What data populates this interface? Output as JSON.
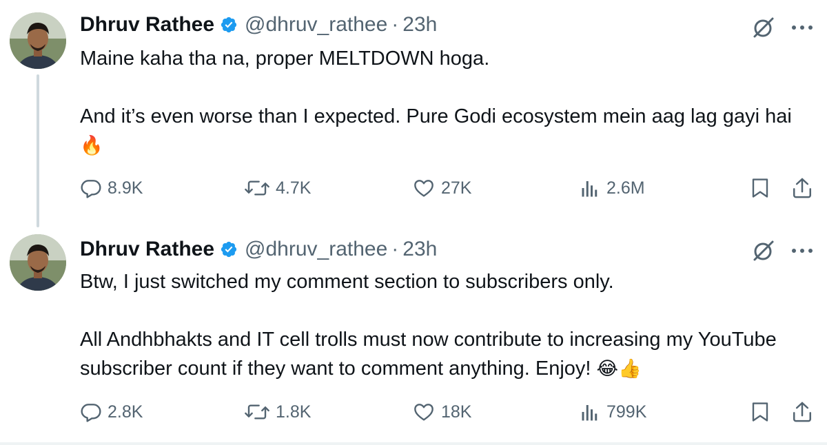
{
  "tweets": [
    {
      "author": {
        "name": "Dhruv Rathee",
        "handle": "@dhruv_rathee",
        "verified": true
      },
      "separator": "·",
      "time": "23h",
      "text": "Maine kaha tha na, proper MELTDOWN hoga.\n\nAnd it’s even worse than I expected. Pure Godi ecosystem mein aag lag gayi hai ",
      "emoji": "🔥",
      "stats": {
        "replies": "8.9K",
        "reposts": "4.7K",
        "likes": "27K",
        "views": "2.6M"
      }
    },
    {
      "author": {
        "name": "Dhruv Rathee",
        "handle": "@dhruv_rathee",
        "verified": true
      },
      "separator": "·",
      "time": "23h",
      "text": "Btw, I just switched my comment section to subscribers only.\n\nAll Andhbhakts and IT cell trolls must now contribute to increasing my YouTube subscriber count if they want to comment anything. Enjoy! ",
      "emoji": "😂👍",
      "stats": {
        "replies": "2.8K",
        "reposts": "1.8K",
        "likes": "18K",
        "views": "799K"
      }
    }
  ],
  "colors": {
    "verified_badge": "#1d9bf0",
    "secondary_text": "#536471",
    "primary_text": "#0f1419",
    "thread_line": "#cfd9de"
  },
  "icons": [
    "verified-badge-icon",
    "grok-icon",
    "more-icon",
    "reply-icon",
    "retweet-icon",
    "like-icon",
    "views-icon",
    "bookmark-icon",
    "share-icon"
  ]
}
